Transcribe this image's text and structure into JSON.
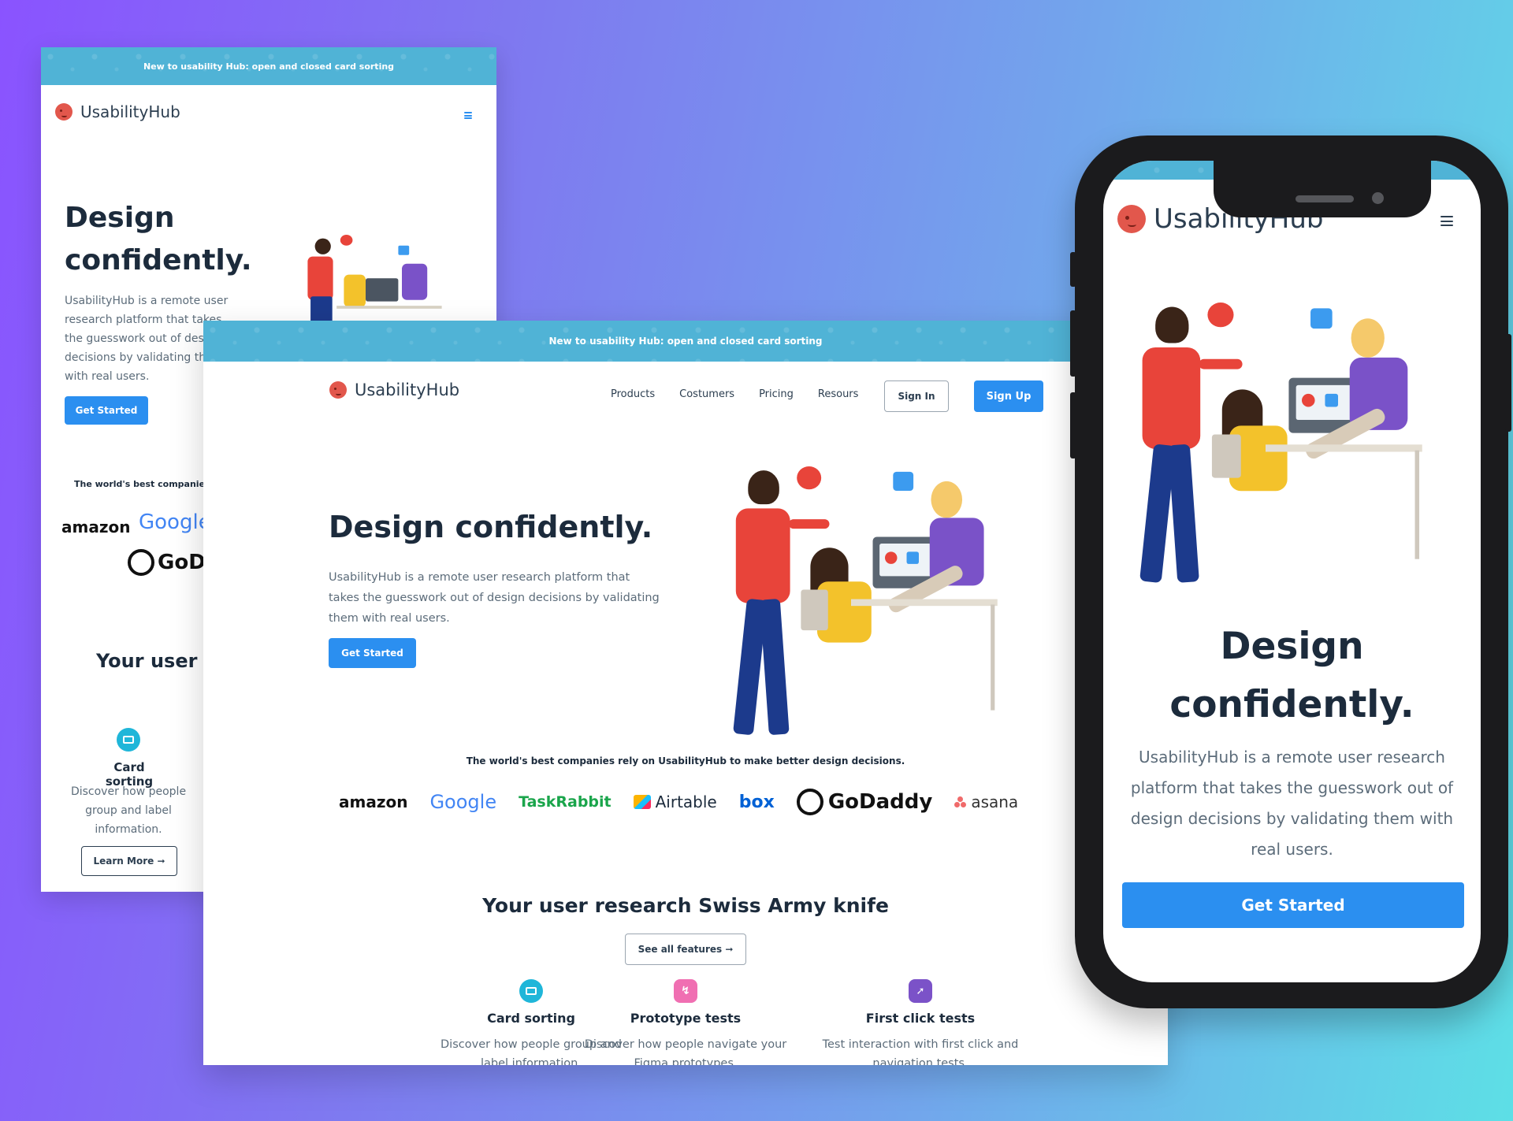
{
  "brand": {
    "name": "UsabilityHub"
  },
  "banner": {
    "text": "New to usability Hub: open and closed card sorting"
  },
  "nav": {
    "items": [
      "Products",
      "Costumers",
      "Pricing",
      "Resours"
    ],
    "sign_in": "Sign In",
    "sign_up": "Sign Up"
  },
  "hero": {
    "title": "Design confidently.",
    "title_line1": "Design",
    "title_line2": "confidently.",
    "body": "UsabilityHub is a remote user research platform that takes the guesswork out of design decisions by validating them with real users.",
    "cta": "Get Started"
  },
  "companies": {
    "heading": "The world's best companies rely on UsabilityHub to make better design decisions.",
    "heading_cropped": "The world's best companies",
    "logos": [
      "amazon",
      "Google",
      "TaskRabbit",
      "Airtable",
      "box",
      "GoDaddy",
      "asana"
    ]
  },
  "section": {
    "title": "Your user research Swiss Army knife",
    "title_cropped": "Your user re",
    "see_all": "See all features ➞"
  },
  "features": [
    {
      "name": "Card sorting",
      "desc": "Discover how people group and label information.",
      "icon": "card-sorting-icon",
      "color": "#1fb6d9"
    },
    {
      "name": "Prototype tests",
      "desc": "Discover how people navigate your Figma prototypes.",
      "icon": "prototype-icon",
      "color": "#f06fb2"
    },
    {
      "name": "First click tests",
      "desc": "Test interaction with first click and navigation tests.",
      "icon": "first-click-icon",
      "color": "#7b52c8"
    }
  ],
  "left_mobile": {
    "learn_more": "Learn More ➞"
  },
  "colors": {
    "accent": "#2b8ff0",
    "banner": "#50b3d6",
    "brand_blob": "#e2574c",
    "dark_text": "#1c2b3c"
  }
}
